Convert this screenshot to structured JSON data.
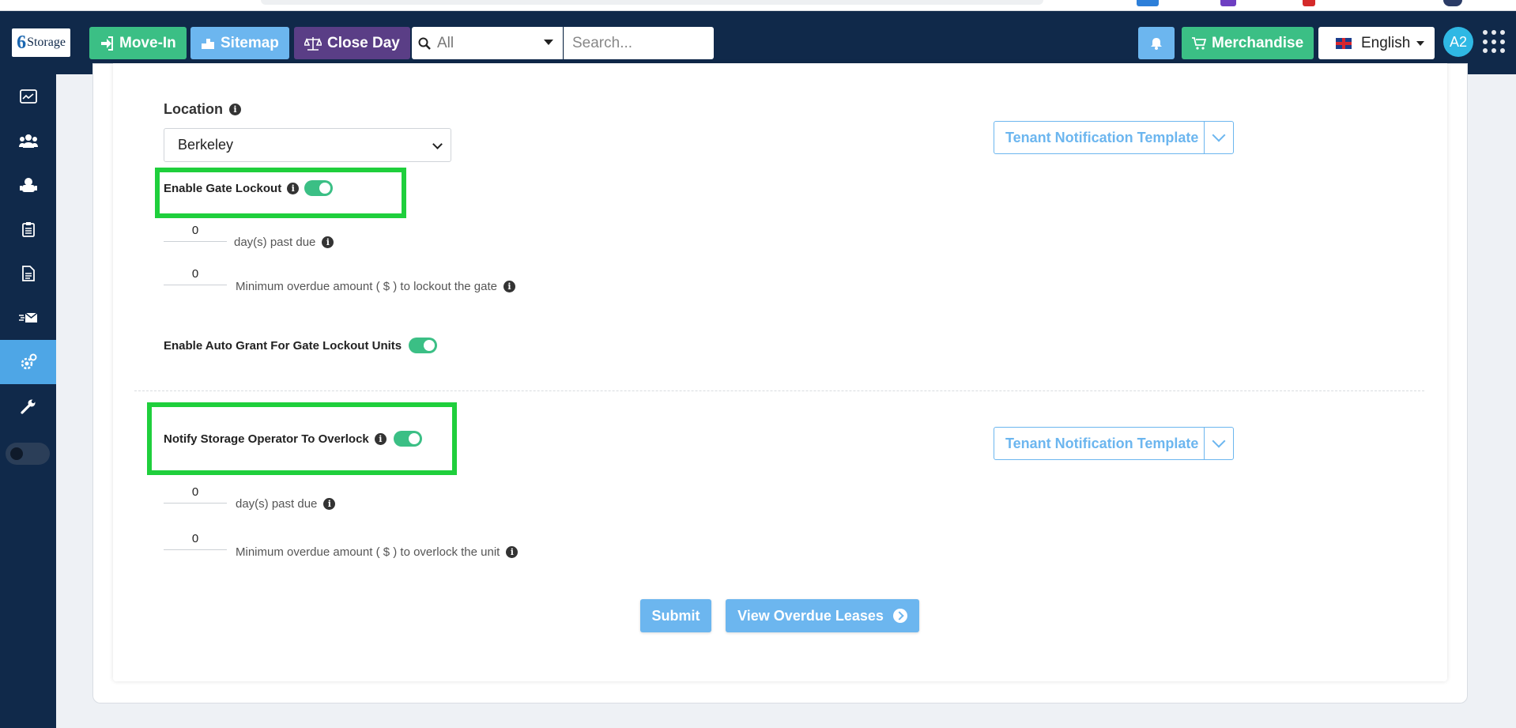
{
  "header": {
    "logo_prefix": "6",
    "logo_text": "Storage",
    "movein_label": "Move-In",
    "sitemap_label": "Sitemap",
    "closeday_label": "Close Day",
    "search_scope": "All",
    "search_placeholder": "Search...",
    "merch_label": "Merchandise",
    "language": "English",
    "avatar_initials": "A2"
  },
  "sidebar": {
    "items": [
      {
        "name": "dashboard-icon"
      },
      {
        "name": "tenants-icon"
      },
      {
        "name": "units-icon"
      },
      {
        "name": "clipboard-icon"
      },
      {
        "name": "documents-icon"
      },
      {
        "name": "messages-icon"
      },
      {
        "name": "settings-icon",
        "active": true
      },
      {
        "name": "wrench-icon"
      }
    ]
  },
  "form": {
    "location_label": "Location",
    "location_value": "Berkeley",
    "template_label": "Tenant Notification Template",
    "gate_lockout_label": "Enable Gate Lockout",
    "gate_days_value": "0",
    "gate_days_label": "day(s) past due",
    "gate_amount_value": "0",
    "gate_amount_label": "Minimum overdue amount ( $ ) to lockout the gate",
    "auto_grant_label": "Enable Auto Grant For Gate Lockout Units",
    "overlock_label": "Notify Storage Operator To Overlock",
    "overlock_days_value": "0",
    "overlock_days_label": "day(s) past due",
    "overlock_amount_value": "0",
    "overlock_amount_label": "Minimum overdue amount ( $ ) to overlock the unit",
    "submit_label": "Submit",
    "view_leases_label": "View Overdue Leases"
  },
  "colors": {
    "navbar": "#10294a",
    "green": "#3bbf85",
    "light_blue": "#6cb6ef",
    "purple": "#5a3e86",
    "highlight": "#1fcf3c"
  }
}
